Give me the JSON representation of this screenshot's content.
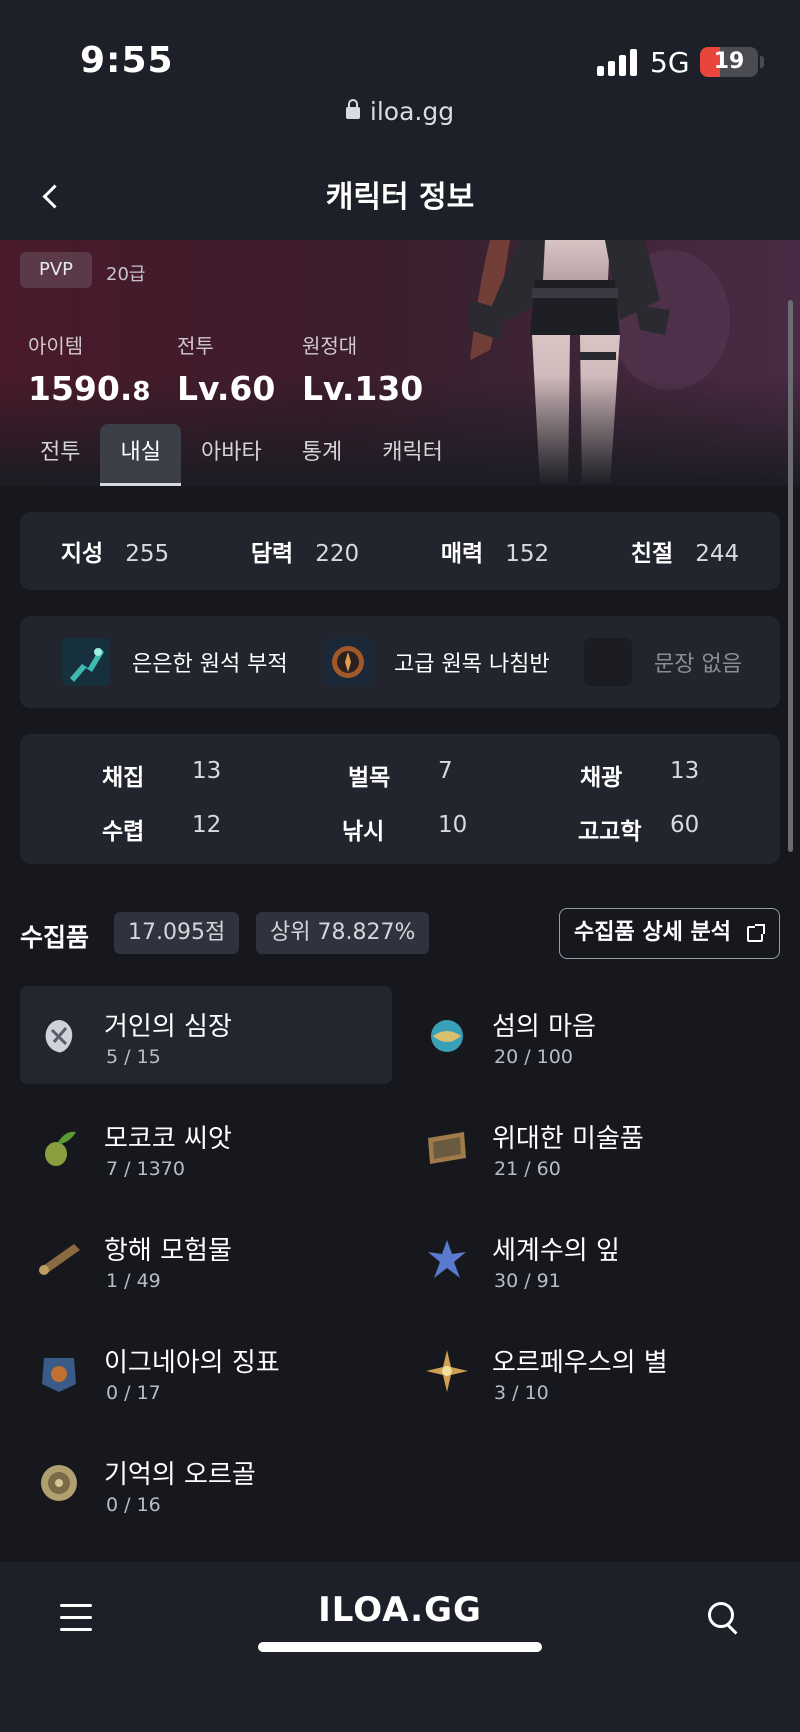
{
  "status_bar": {
    "time": "9:55",
    "network": "5G",
    "battery": "19"
  },
  "browser": {
    "url": "iloa.gg"
  },
  "header": {
    "title": "캐릭터 정보"
  },
  "hero": {
    "pvp": "PVP",
    "grade": "20급",
    "stats": [
      {
        "label": "아이템",
        "value": "1590.",
        "value_small": "8"
      },
      {
        "label": "전투",
        "value": "Lv.60",
        "value_small": ""
      },
      {
        "label": "원정대",
        "value": "Lv.130",
        "value_small": ""
      }
    ],
    "tabs": [
      "전투",
      "내실",
      "아바타",
      "통계",
      "캐릭터"
    ],
    "active_tab": "내실"
  },
  "traits": [
    {
      "name": "지성",
      "value": "255"
    },
    {
      "name": "담력",
      "value": "220"
    },
    {
      "name": "매력",
      "value": "152"
    },
    {
      "name": "친절",
      "value": "244"
    }
  ],
  "items": [
    {
      "name": "은은한 원석 부적",
      "icon": "amulet-icon"
    },
    {
      "name": "고급 원목 나침반",
      "icon": "compass-icon"
    },
    {
      "name": "문장 없음",
      "icon": "empty-slot-icon"
    }
  ],
  "life_skills": [
    {
      "name": "채집",
      "value": "13"
    },
    {
      "name": "벌목",
      "value": "7"
    },
    {
      "name": "채광",
      "value": "13"
    },
    {
      "name": "수렵",
      "value": "12"
    },
    {
      "name": "낚시",
      "value": "10"
    },
    {
      "name": "고고학",
      "value": "60"
    }
  ],
  "collectibles": {
    "title": "수집품",
    "score": "17.095점",
    "rank": "상위 78.827%",
    "detail_button": "수집품 상세 분석",
    "list": [
      {
        "name": "거인의 심장",
        "count": "5 / 15",
        "icon": "giant-heart-icon"
      },
      {
        "name": "섬의 마음",
        "count": "20 / 100",
        "icon": "island-heart-icon"
      },
      {
        "name": "모코코 씨앗",
        "count": "7 / 1370",
        "icon": "mokoko-seed-icon"
      },
      {
        "name": "위대한 미술품",
        "count": "21 / 60",
        "icon": "artwork-icon"
      },
      {
        "name": "항해 모험물",
        "count": "1 / 49",
        "icon": "telescope-icon"
      },
      {
        "name": "세계수의 잎",
        "count": "30 / 91",
        "icon": "leaf-icon"
      },
      {
        "name": "이그네아의 징표",
        "count": "0 / 17",
        "icon": "ignea-token-icon"
      },
      {
        "name": "오르페우스의 별",
        "count": "3 / 10",
        "icon": "star-icon"
      },
      {
        "name": "기억의 오르골",
        "count": "0 / 16",
        "icon": "orgel-icon"
      }
    ]
  },
  "bottom_bar": {
    "logo": "ILOA.GG"
  },
  "colors": {
    "background": "#16181e",
    "card": "#22252d",
    "hero_tint": "#4a1a2a"
  }
}
